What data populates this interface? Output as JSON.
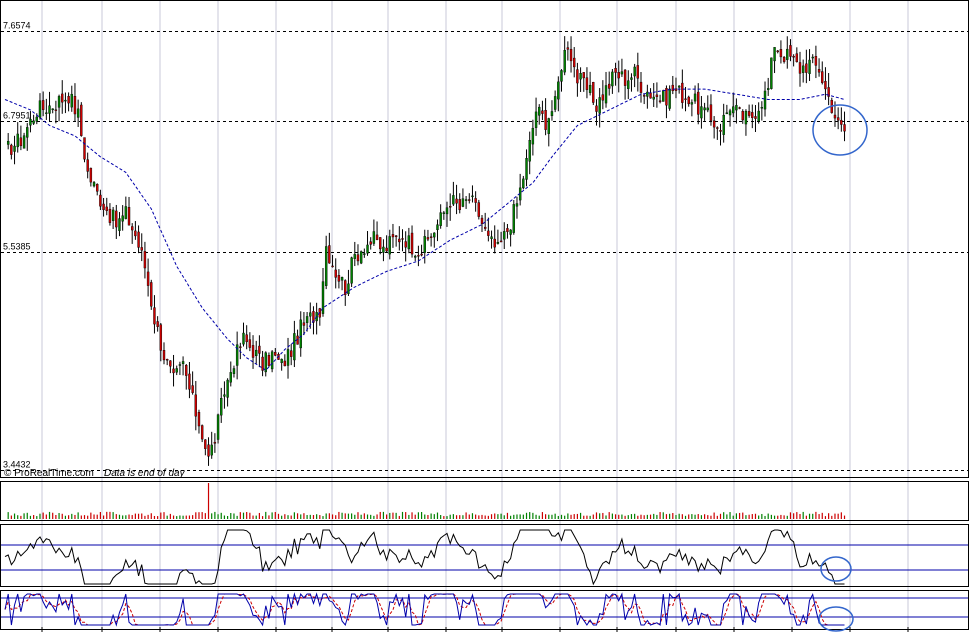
{
  "chart_data": [
    {
      "type": "candlestick",
      "pane": "price",
      "ylim": [
        3.4432,
        7.6574
      ],
      "level_labels": [
        "7.6574",
        "6.7951",
        "5.5385",
        "3.4432"
      ],
      "levels": [
        7.6574,
        6.7951,
        5.5385,
        3.4432
      ],
      "moving_average": "dashed-blue",
      "watermark": "© ProRealTime.com",
      "watermark_note": "Data is end of day",
      "annotation": "blue circle around last candles",
      "colors": {
        "up": "#008000",
        "down": "#cc0000",
        "wick": "#000000",
        "ma": "#0000aa",
        "circle": "#3366cc"
      },
      "close_path": [
        [
          0,
          6.5
        ],
        [
          5,
          6.62
        ],
        [
          10,
          6.9
        ],
        [
          15,
          6.95
        ],
        [
          20,
          7.05
        ],
        [
          23,
          6.85
        ],
        [
          26,
          6.3
        ],
        [
          29,
          6.1
        ],
        [
          32,
          5.95
        ],
        [
          35,
          5.8
        ],
        [
          38,
          5.9
        ],
        [
          41,
          5.7
        ],
        [
          44,
          5.4
        ],
        [
          47,
          4.9
        ],
        [
          50,
          4.55
        ],
        [
          53,
          4.3
        ],
        [
          56,
          4.45
        ],
        [
          59,
          4.1
        ],
        [
          62,
          3.8
        ],
        [
          64,
          3.55
        ],
        [
          66,
          3.75
        ],
        [
          69,
          4.2
        ],
        [
          72,
          4.5
        ],
        [
          75,
          4.7
        ],
        [
          78,
          4.6
        ],
        [
          81,
          4.45
        ],
        [
          84,
          4.55
        ],
        [
          87,
          4.45
        ],
        [
          90,
          4.6
        ],
        [
          93,
          4.8
        ],
        [
          96,
          4.9
        ],
        [
          99,
          5.0
        ],
        [
          101,
          5.6
        ],
        [
          104,
          5.35
        ],
        [
          107,
          5.2
        ],
        [
          110,
          5.5
        ],
        [
          113,
          5.6
        ],
        [
          116,
          5.65
        ],
        [
          119,
          5.55
        ],
        [
          122,
          5.65
        ],
        [
          125,
          5.7
        ],
        [
          128,
          5.6
        ],
        [
          131,
          5.55
        ],
        [
          134,
          5.7
        ],
        [
          137,
          5.85
        ],
        [
          140,
          6.05
        ],
        [
          143,
          5.95
        ],
        [
          146,
          6.05
        ],
        [
          149,
          5.9
        ],
        [
          152,
          5.65
        ],
        [
          155,
          5.55
        ],
        [
          158,
          5.75
        ],
        [
          161,
          6.0
        ],
        [
          164,
          6.4
        ],
        [
          167,
          6.9
        ],
        [
          170,
          6.8
        ],
        [
          173,
          6.95
        ],
        [
          175,
          7.35
        ],
        [
          177,
          7.55
        ],
        [
          180,
          7.2
        ],
        [
          183,
          7.1
        ],
        [
          186,
          6.95
        ],
        [
          189,
          7.1
        ],
        [
          192,
          7.25
        ],
        [
          195,
          7.2
        ],
        [
          198,
          7.25
        ],
        [
          201,
          7.1
        ],
        [
          204,
          7.05
        ],
        [
          207,
          7.0
        ],
        [
          210,
          7.1
        ],
        [
          213,
          7.05
        ],
        [
          216,
          7.0
        ],
        [
          219,
          6.9
        ],
        [
          222,
          6.8
        ],
        [
          225,
          6.75
        ],
        [
          228,
          6.95
        ],
        [
          231,
          6.85
        ],
        [
          234,
          6.8
        ],
        [
          237,
          6.95
        ],
        [
          240,
          7.1
        ],
        [
          242,
          7.55
        ],
        [
          244,
          7.45
        ],
        [
          247,
          7.4
        ],
        [
          250,
          7.3
        ],
        [
          253,
          7.35
        ],
        [
          256,
          7.3
        ],
        [
          258,
          7.1
        ],
        [
          260,
          6.95
        ],
        [
          262,
          6.75
        ],
        [
          264,
          6.7
        ]
      ],
      "ma_path": [
        [
          0,
          7.0
        ],
        [
          8,
          6.9
        ],
        [
          14,
          6.75
        ],
        [
          22,
          6.65
        ],
        [
          30,
          6.45
        ],
        [
          38,
          6.3
        ],
        [
          46,
          5.95
        ],
        [
          54,
          5.4
        ],
        [
          62,
          5.0
        ],
        [
          70,
          4.7
        ],
        [
          76,
          4.52
        ],
        [
          82,
          4.4
        ],
        [
          88,
          4.6
        ],
        [
          94,
          4.75
        ],
        [
          100,
          5.0
        ],
        [
          110,
          5.2
        ],
        [
          120,
          5.35
        ],
        [
          130,
          5.45
        ],
        [
          140,
          5.65
        ],
        [
          150,
          5.8
        ],
        [
          158,
          6.0
        ],
        [
          166,
          6.2
        ],
        [
          172,
          6.45
        ],
        [
          180,
          6.75
        ],
        [
          190,
          6.9
        ],
        [
          200,
          7.05
        ],
        [
          210,
          7.1
        ],
        [
          220,
          7.1
        ],
        [
          230,
          7.05
        ],
        [
          240,
          7.0
        ],
        [
          250,
          7.0
        ],
        [
          258,
          7.05
        ],
        [
          264,
          7.0
        ]
      ]
    },
    {
      "type": "bar",
      "pane": "volume",
      "colors": {
        "up": "#008000",
        "down": "#cc0000"
      },
      "spike_index": 64,
      "spike_value": 1.0,
      "base_value": 0.08
    },
    {
      "type": "line",
      "pane": "indicator-1",
      "band_levels": [
        0.25,
        0.75
      ],
      "colors": {
        "line": "#000000",
        "bands": "#0000aa",
        "circle": "#3366cc"
      }
    },
    {
      "type": "line",
      "pane": "indicator-2",
      "band_levels": [
        0.2,
        0.8
      ],
      "series_colors": {
        "main": "#0000aa",
        "signal": "#cc0000",
        "bands": "#0000aa",
        "circle": "#3366cc"
      }
    }
  ]
}
